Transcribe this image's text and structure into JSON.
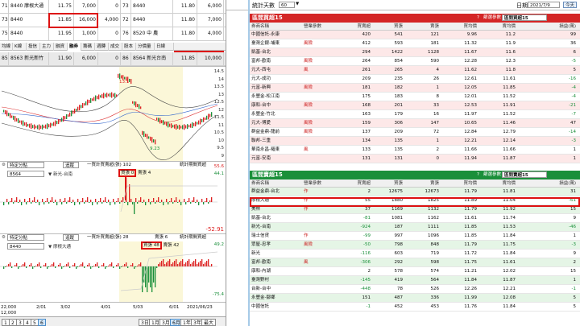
{
  "order_book": {
    "rows": [
      {
        "no": "71",
        "code_name": "8440 摩根大通",
        "price": "11.75",
        "vol": "7,000",
        "amt": "0",
        "no2": "73",
        "code2": "8440",
        "price2": "11.80",
        "vol2": "6,000",
        "amt2": "0"
      },
      {
        "no": "73",
        "code_name": "8440",
        "price": "11.85",
        "vol": "16,000",
        "amt": "4,000",
        "no2": "72",
        "code2": "8440",
        "price2": "11.80",
        "vol2": "7,000",
        "amt2": "3,000"
      },
      {
        "no": "75",
        "code_name": "8440",
        "price": "11.95",
        "vol": "1,000",
        "amt": "0",
        "no2": "76",
        "code2": "8520 中 農",
        "price2": "11.80",
        "vol2": "4,000",
        "amt2": "0"
      }
    ],
    "selected": {
      "no": "85",
      "code_name": "8563 新光新竹",
      "price": "11.90",
      "vol": "6,000",
      "amt": "0",
      "no2": "86",
      "code2": "8564 新光台南",
      "price2": "11.85",
      "vol2": "10,000",
      "amt2": "0"
    }
  },
  "tabs": [
    "均線",
    "K線",
    "投信",
    "主力",
    "融資",
    "融券",
    "籌碼",
    "週轉",
    "成交",
    "股本",
    "分價量",
    "日線"
  ],
  "price_chart": {
    "high_label": "13.1",
    "low_label": "9.23",
    "scale": [
      "14.5",
      "14",
      "13.5",
      "13",
      "12.5",
      "12",
      "11.5",
      "11",
      "10.5",
      "10",
      "9.5",
      "9"
    ]
  },
  "panel1": {
    "dropdown": "特定分點",
    "add_label": "追蹤",
    "title": "一買計買賣超(張) 102",
    "buy_label": "買張 0",
    "sell_label": "賣張 4",
    "right_label": "統計期間買超",
    "broker": "8564",
    "broker_name": "新光-台南",
    "scale_top": "55.6",
    "scale_mid": "44.1",
    "scale_low": "-52.91"
  },
  "panel2": {
    "dropdown": "特定分點",
    "add_label": "追蹤",
    "title": "一買計買賣超(張) 28",
    "buy_label": "買張 48",
    "sell_label": "賣張 42",
    "sell_top": "賣張 6",
    "right_label": "統計期間買超",
    "broker": "8440",
    "broker_name": "摩根大通",
    "scale_top": "49.2",
    "scale_low": "-75.4"
  },
  "x_axis": {
    "left_top": "22,000",
    "left_bottom": "12,000",
    "ticks": [
      "2/01",
      "3/02",
      "4/01",
      "5/03",
      "6/01",
      "2021/06/23"
    ]
  },
  "range_buttons": [
    "3日",
    "1月",
    "3月",
    "6月",
    "1年",
    "3年",
    "最大"
  ],
  "page_buttons": [
    "1",
    "2",
    "3",
    "4",
    "5",
    "6"
  ],
  "right_top": {
    "label": "統計天數",
    "value": "60",
    "date_label": "日期",
    "date": "2021/7/9",
    "today": "今天"
  },
  "buy_section": {
    "title": "區間買超15",
    "filter_label": "篩選參數",
    "filter_value": "區間買超15",
    "headers": [
      "券商名稱",
      "營業參數",
      "買賣超",
      "買張",
      "賣張",
      "買均價",
      "賣均價",
      "損益(萬)"
    ],
    "rows": [
      {
        "name": "中國信託-永康",
        "flag": "",
        "net": "420",
        "buy": "541",
        "sell": "121",
        "bavg": "9.96",
        "savg": "11.2",
        "pl": "99"
      },
      {
        "name": "臺灣企銀-埔東",
        "flag": "風險",
        "net": "412",
        "buy": "593",
        "sell": "181",
        "bavg": "11.32",
        "savg": "11.9",
        "pl": "36"
      },
      {
        "name": "凱基-台北",
        "flag": "",
        "net": "294",
        "buy": "1422",
        "sell": "1128",
        "bavg": "11.67",
        "savg": "11.6",
        "pl": "6"
      },
      {
        "name": "富邦-歡南",
        "flag": "風險",
        "net": "264",
        "buy": "854",
        "sell": "590",
        "bavg": "12.28",
        "savg": "12.3",
        "pl": "-5"
      },
      {
        "name": "元大-西屯",
        "flag": "風",
        "net": "261",
        "buy": "265",
        "sell": "4",
        "bavg": "11.62",
        "savg": "11.8",
        "pl": "5"
      },
      {
        "name": "元大-成功",
        "flag": "",
        "net": "209",
        "buy": "235",
        "sell": "26",
        "bavg": "12.61",
        "savg": "11.61",
        "pl": "-16"
      },
      {
        "name": "元富-新興",
        "flag": "風險",
        "net": "181",
        "buy": "182",
        "sell": "1",
        "bavg": "12.05",
        "savg": "11.85",
        "pl": "-4"
      },
      {
        "name": "永豐金-松江南",
        "flag": "",
        "net": "175",
        "buy": "183",
        "sell": "8",
        "bavg": "12.01",
        "savg": "11.52",
        "pl": "-4"
      },
      {
        "name": "康和-台中",
        "flag": "風險",
        "net": "168",
        "buy": "201",
        "sell": "33",
        "bavg": "12.53",
        "savg": "11.91",
        "pl": "-21"
      },
      {
        "name": "永豐金-竹北",
        "flag": "",
        "net": "163",
        "buy": "179",
        "sell": "16",
        "bavg": "11.97",
        "savg": "11.52",
        "pl": "-7"
      },
      {
        "name": "元大-博愛",
        "flag": "風險",
        "net": "159",
        "buy": "306",
        "sell": "147",
        "bavg": "10.65",
        "savg": "11.46",
        "pl": "47"
      },
      {
        "name": "群益金鼎-龍前",
        "flag": "風險",
        "net": "137",
        "buy": "209",
        "sell": "72",
        "bavg": "12.84",
        "savg": "12.79",
        "pl": "-14"
      },
      {
        "name": "聯邦-三重",
        "flag": "",
        "net": "134",
        "buy": "135",
        "sell": "1",
        "bavg": "12.21",
        "savg": "12.14",
        "pl": "-3"
      },
      {
        "name": "華南永昌-羅東",
        "flag": "風",
        "net": "133",
        "buy": "135",
        "sell": "2",
        "bavg": "11.66",
        "savg": "11.66",
        "pl": "1"
      },
      {
        "name": "元富-安南",
        "flag": "",
        "net": "131",
        "buy": "131",
        "sell": "0",
        "bavg": "11.94",
        "savg": "11.87",
        "pl": "1"
      }
    ]
  },
  "sell_section": {
    "title": "區間賣超15",
    "filter_label": "篩選參數",
    "filter_value": "區間賣超15",
    "headers": [
      "券商名稱",
      "營業參數",
      "買賣超",
      "買張",
      "賣張",
      "買均價",
      "賣均價",
      "損益(萬)"
    ],
    "rows": [
      {
        "name": "群益金鼎-台北",
        "flag": "作",
        "net": "2",
        "buy": "12675",
        "sell": "12673",
        "bavg": "11.79",
        "savg": "11.81",
        "pl": "31"
      },
      {
        "name": "摩根大通",
        "flag": "作",
        "net": "55",
        "buy": "1880",
        "sell": "1825",
        "bavg": "11.89",
        "savg": "11.04",
        "pl": "-61"
      },
      {
        "name": "美林",
        "flag": "作",
        "net": "37",
        "buy": "1169",
        "sell": "1132",
        "bavg": "11.79",
        "savg": "11.92",
        "pl": "15"
      },
      {
        "name": "凱基-台北",
        "flag": "",
        "net": "-81",
        "buy": "1081",
        "sell": "1162",
        "bavg": "11.61",
        "savg": "11.74",
        "pl": "9"
      },
      {
        "name": "新光-台南",
        "flag": "",
        "net": "-924",
        "buy": "187",
        "sell": "1111",
        "bavg": "11.85",
        "savg": "11.53",
        "pl": "-46"
      },
      {
        "name": "瑞士信貸",
        "flag": "作",
        "net": "-99",
        "buy": "997",
        "sell": "1096",
        "bavg": "11.85",
        "savg": "11.84",
        "pl": "1"
      },
      {
        "name": "眾屋-忠孝",
        "flag": "風險",
        "net": "-50",
        "buy": "798",
        "sell": "848",
        "bavg": "11.79",
        "savg": "11.75",
        "pl": "-3"
      },
      {
        "name": "新光",
        "flag": "",
        "net": "-116",
        "buy": "603",
        "sell": "719",
        "bavg": "11.72",
        "savg": "11.84",
        "pl": "9"
      },
      {
        "name": "富邦-歡南",
        "flag": "風",
        "net": "-306",
        "buy": "292",
        "sell": "598",
        "bavg": "11.75",
        "savg": "11.61",
        "pl": "2"
      },
      {
        "name": "康和-內湖",
        "flag": "",
        "net": "2",
        "buy": "578",
        "sell": "574",
        "bavg": "11.21",
        "savg": "12.02",
        "pl": "15"
      },
      {
        "name": "臺灣野村",
        "flag": "",
        "net": "-145",
        "buy": "419",
        "sell": "564",
        "bavg": "11.84",
        "savg": "11.87",
        "pl": "1"
      },
      {
        "name": "台新-台中",
        "flag": "",
        "net": "-448",
        "buy": "78",
        "sell": "526",
        "bavg": "12.26",
        "savg": "12.21",
        "pl": "-1"
      },
      {
        "name": "永豐金-鄒鄉",
        "flag": "",
        "net": "151",
        "buy": "487",
        "sell": "336",
        "bavg": "11.99",
        "savg": "12.08",
        "pl": "5"
      },
      {
        "name": "中國信託",
        "flag": "",
        "net": "-1",
        "buy": "452",
        "sell": "453",
        "bavg": "11.76",
        "savg": "11.84",
        "pl": "5"
      }
    ]
  }
}
